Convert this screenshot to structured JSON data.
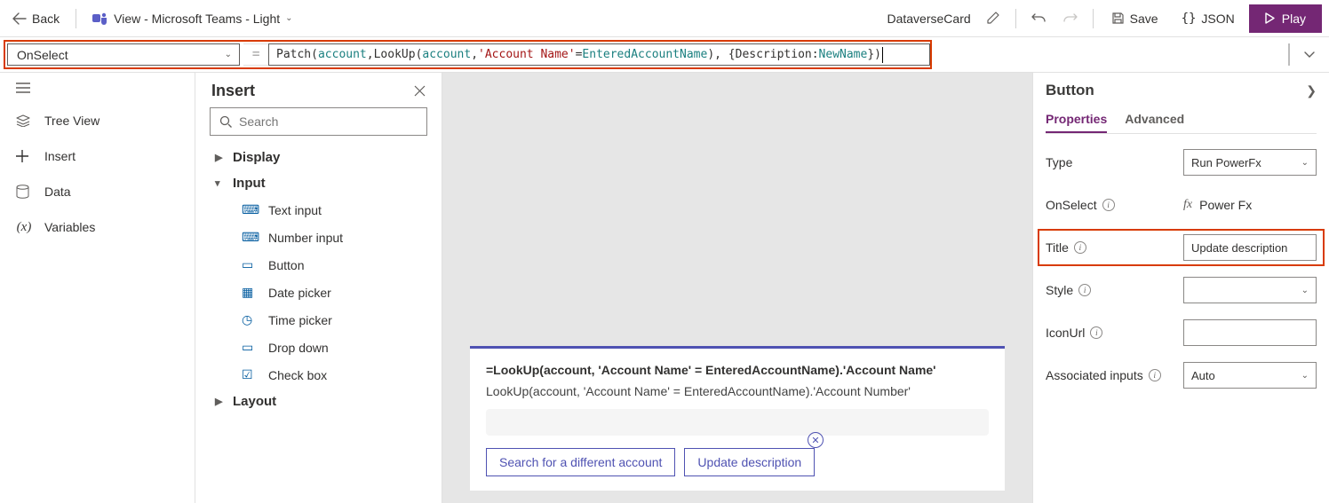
{
  "cmdbar": {
    "back": "Back",
    "view": "View - Microsoft Teams - Light",
    "doc": "DataverseCard",
    "save": "Save",
    "json": "JSON",
    "play": "Play"
  },
  "formula": {
    "property": "OnSelect",
    "tokens": {
      "patch": "Patch",
      "lp": "(",
      "account1": "account",
      "comma1": ", ",
      "lookup": "LookUp",
      "lp2": "(",
      "account2": "account",
      "comma2": ", ",
      "field": "'Account Name'",
      "eq": " = ",
      "entered": "EnteredAccountName",
      "rp2": ")",
      "comma3": ", { ",
      "desc": "Description: ",
      "newname": "NewName",
      "rp": " })"
    }
  },
  "rail": {
    "tree": "Tree View",
    "insert": "Insert",
    "data": "Data",
    "variables": "Variables"
  },
  "insert": {
    "title": "Insert",
    "search_placeholder": "Search",
    "groups": {
      "display": "Display",
      "input": "Input",
      "layout": "Layout"
    },
    "items": {
      "text_input": "Text input",
      "number_input": "Number input",
      "button": "Button",
      "date_picker": "Date picker",
      "time_picker": "Time picker",
      "drop_down": "Drop down",
      "check_box": "Check box"
    }
  },
  "canvas": {
    "line1": "=LookUp(account, 'Account Name' = EnteredAccountName).'Account Name'",
    "line2": "LookUp(account, 'Account Name' = EnteredAccountName).'Account Number'",
    "btn_search": "Search for a different account",
    "btn_update": "Update description"
  },
  "props": {
    "header": "Button",
    "tabs": {
      "properties": "Properties",
      "advanced": "Advanced"
    },
    "rows": {
      "type": "Type",
      "type_val": "Run PowerFx",
      "onselect": "OnSelect",
      "onselect_val": "Power Fx",
      "title": "Title",
      "title_val": "Update description",
      "style": "Style",
      "iconurl": "IconUrl",
      "assoc": "Associated inputs",
      "assoc_val": "Auto"
    }
  }
}
